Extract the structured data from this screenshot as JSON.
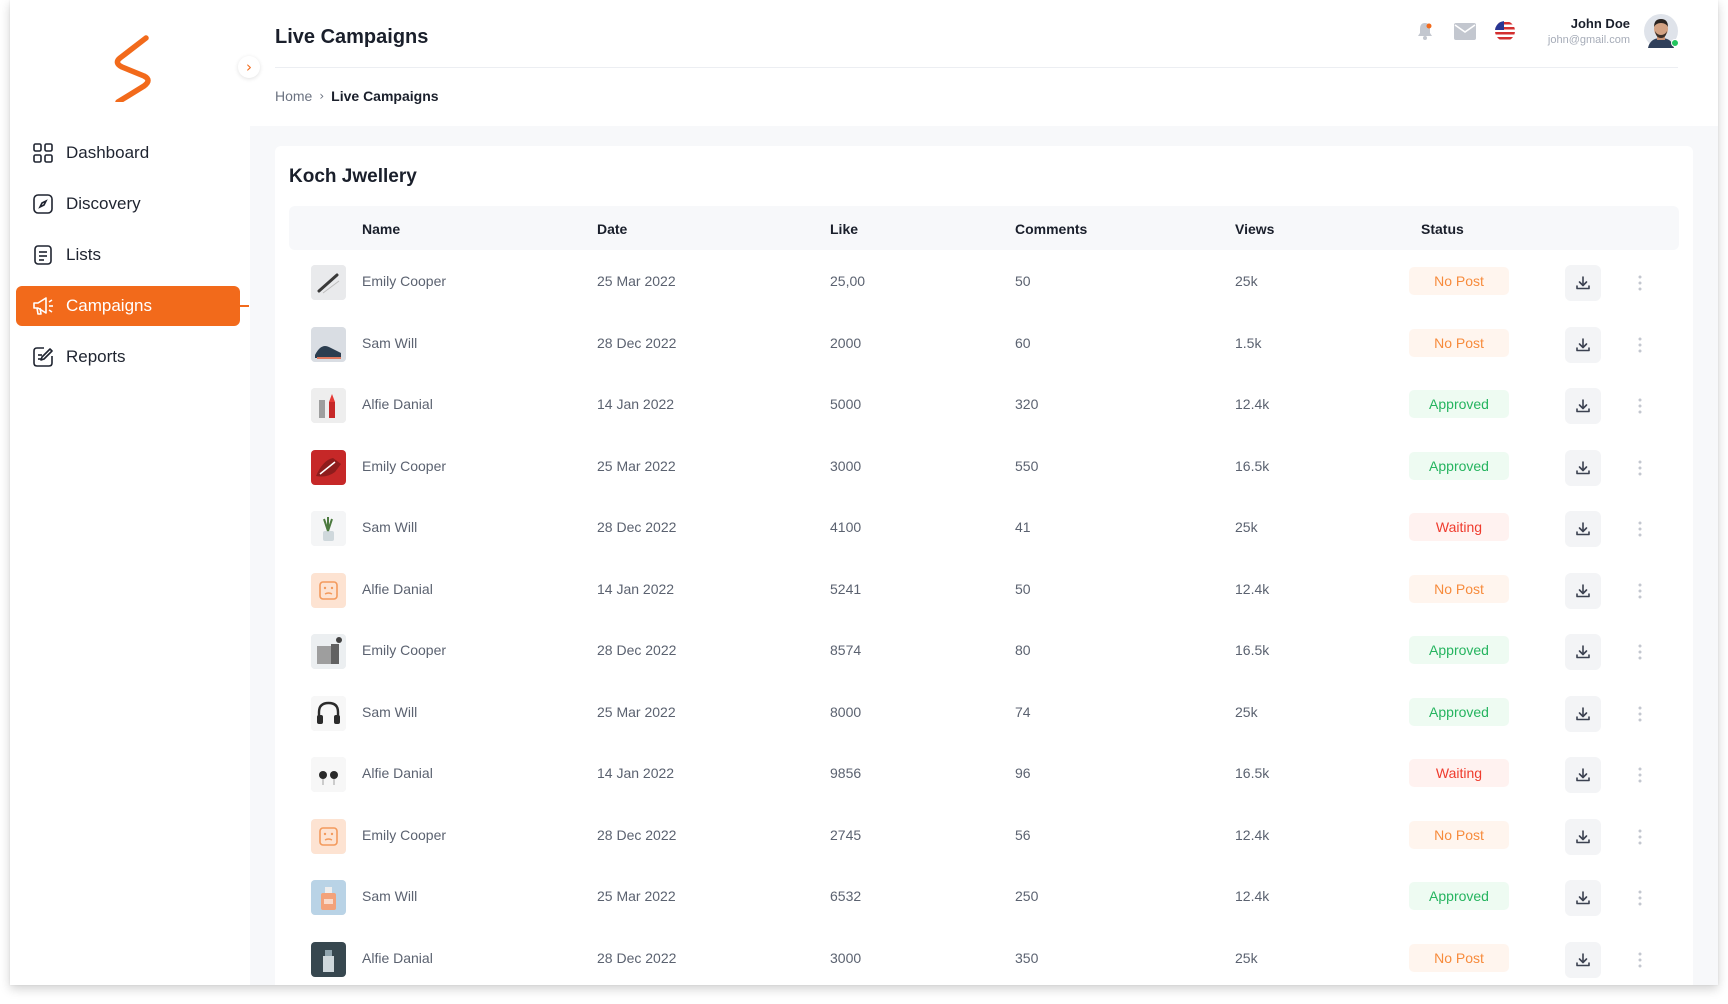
{
  "app": {
    "accent": "#f26a1b",
    "logo_icon": "s-brand-logo",
    "collapse_icon": "chevron-right-icon"
  },
  "sidebar": {
    "items": [
      {
        "label": "Dashboard",
        "icon": "grid-icon",
        "active": false
      },
      {
        "label": "Discovery",
        "icon": "compass-icon",
        "active": false
      },
      {
        "label": "Lists",
        "icon": "list-icon",
        "active": false
      },
      {
        "label": "Campaigns",
        "icon": "megaphone-icon",
        "active": true
      },
      {
        "label": "Reports",
        "icon": "report-edit-icon",
        "active": false
      }
    ]
  },
  "header": {
    "title": "Live Campaigns",
    "icons": [
      "bell-icon",
      "mail-icon",
      "us-flag-icon"
    ],
    "user": {
      "name": "John Doe",
      "email": "john@gmail.com"
    }
  },
  "breadcrumb": {
    "home": "Home",
    "current": "Live Campaigns"
  },
  "card": {
    "title": "Koch Jwellery",
    "columns": {
      "name": "Name",
      "date": "Date",
      "like": "Like",
      "comments": "Comments",
      "views": "Views",
      "status": "Status"
    }
  },
  "rows": [
    {
      "thumb": "pen-product",
      "name": "Emily Cooper",
      "date": "25 Mar 2022",
      "like": "25,00",
      "comments": "50",
      "views": "25k",
      "status": "No Post",
      "status_type": "nopost"
    },
    {
      "thumb": "shoe-product",
      "name": "Sam Will",
      "date": "28 Dec 2022",
      "like": "2000",
      "comments": "60",
      "views": "1.5k",
      "status": "No Post",
      "status_type": "nopost"
    },
    {
      "thumb": "lipstick-product",
      "name": "Alfie Danial",
      "date": "14 Jan 2022",
      "like": "5000",
      "comments": "320",
      "views": "12.4k",
      "status": "Approved",
      "status_type": "approved"
    },
    {
      "thumb": "sneaker-product",
      "name": "Emily Cooper",
      "date": "25 Mar 2022",
      "like": "3000",
      "comments": "550",
      "views": "16.5k",
      "status": "Approved",
      "status_type": "approved"
    },
    {
      "thumb": "plant-product",
      "name": "Sam Will",
      "date": "28 Dec 2022",
      "like": "4100",
      "comments": "41",
      "views": "25k",
      "status": "Waiting",
      "status_type": "waiting"
    },
    {
      "thumb": "placeholder-face",
      "name": "Alfie Danial",
      "date": "14 Jan 2022",
      "like": "5241",
      "comments": "50",
      "views": "12.4k",
      "status": "No Post",
      "status_type": "nopost"
    },
    {
      "thumb": "cosmetic-product",
      "name": "Emily Cooper",
      "date": "28 Dec 2022",
      "like": "8574",
      "comments": "80",
      "views": "16.5k",
      "status": "Approved",
      "status_type": "approved"
    },
    {
      "thumb": "headphones-product",
      "name": "Sam Will",
      "date": "25 Mar 2022",
      "like": "8000",
      "comments": "74",
      "views": "25k",
      "status": "Approved",
      "status_type": "approved"
    },
    {
      "thumb": "earbuds-product",
      "name": "Alfie Danial",
      "date": "14 Jan 2022",
      "like": "9856",
      "comments": "96",
      "views": "16.5k",
      "status": "Waiting",
      "status_type": "waiting"
    },
    {
      "thumb": "placeholder-face",
      "name": "Emily Cooper",
      "date": "28 Dec 2022",
      "like": "2745",
      "comments": "56",
      "views": "12.4k",
      "status": "No Post",
      "status_type": "nopost"
    },
    {
      "thumb": "perfume-product",
      "name": "Sam Will",
      "date": "25 Mar 2022",
      "like": "6532",
      "comments": "250",
      "views": "12.4k",
      "status": "Approved",
      "status_type": "approved"
    },
    {
      "thumb": "dark-product",
      "name": "Alfie Danial",
      "date": "28 Dec 2022",
      "like": "3000",
      "comments": "350",
      "views": "25k",
      "status": "No Post",
      "status_type": "nopost"
    }
  ],
  "row_actions": {
    "download_icon": "download-icon",
    "more_icon": "more-vertical-icon"
  }
}
